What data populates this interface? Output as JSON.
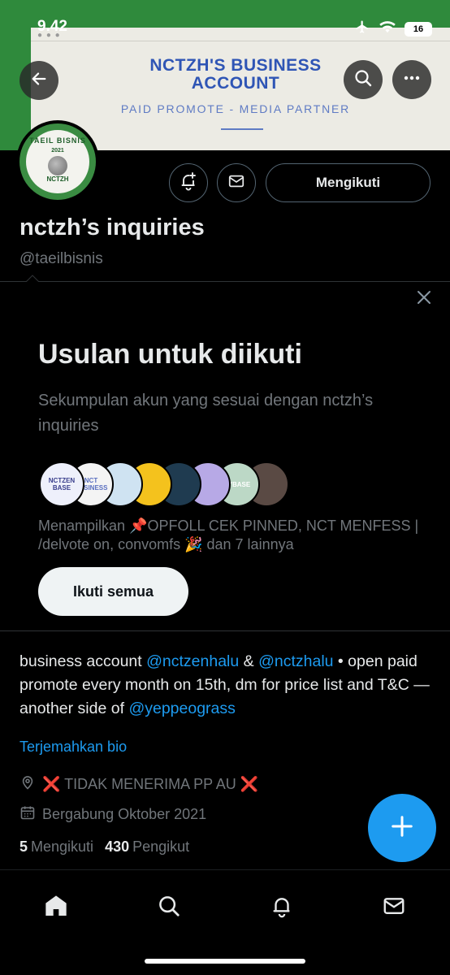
{
  "status_bar": {
    "time": "9.42",
    "battery": "16"
  },
  "banner": {
    "title_line1": "NCTZH'S BUSINESS",
    "title_line2": "ACCOUNT",
    "subtitle": "PAID PROMOTE - MEDIA PARTNER"
  },
  "avatar": {
    "ring_text": "TAEIL BISNIS",
    "year": "2021",
    "brand": "NCTZH"
  },
  "profile": {
    "follow_label": "Mengikuti",
    "name": "nctzh’s inquiries",
    "handle": "@taeilbisnis"
  },
  "suggestions": {
    "title": "Usulan untuk diikuti",
    "subtitle": "Sekumpulan akun yang sesuai dengan nctzh’s inquiries",
    "avatars": [
      {
        "label": "NCTZEN BASE",
        "color": "#eef0fb",
        "text_color": "#3a3f8c"
      },
      {
        "label": "NCT BUSINESS",
        "color": "#f4f4f4",
        "text_color": "#5a6fc0"
      },
      {
        "label": "",
        "color": "#cfe3f2",
        "text_color": "#2a5d8c"
      },
      {
        "label": "",
        "color": "#f4c21d",
        "text_color": "#7a5a00"
      },
      {
        "label": "",
        "color": "#1f3b50",
        "text_color": "#e8d35a"
      },
      {
        "label": "",
        "color": "#b7a9e6",
        "text_color": "#ffffff"
      },
      {
        "label": "TYBASE",
        "color": "#bcd8c6",
        "text_color": "#ffffff"
      },
      {
        "label": "",
        "color": "#5a4a44",
        "text_color": "#ffffff"
      }
    ],
    "showing_text": "Menampilkan 📌OPFOLL CEK PINNED, NCT MENFESS | /delvote on, convomfs 🎉 dan 7 lainnya",
    "follow_all_label": "Ikuti semua"
  },
  "bio": {
    "part1": "business account ",
    "mention1": "@nctzenhalu",
    "part2": " & ",
    "mention2": "@nctzhalu",
    "part3": " • open paid promote every month on 15th, dm for price list and T&C — another side of ",
    "mention3": "@yeppeograss",
    "translate_label": "Terjemahkan bio",
    "location": "❌ TIDAK MENERIMA PP AU ❌",
    "joined": "Bergabung Oktober 2021"
  },
  "counts": {
    "following_num": "5",
    "following_label": "Mengikuti",
    "followers_num": "430",
    "followers_label": "Pengikut"
  },
  "colors": {
    "accent": "#1d9bf0",
    "background": "#000000",
    "muted": "#71767b"
  }
}
